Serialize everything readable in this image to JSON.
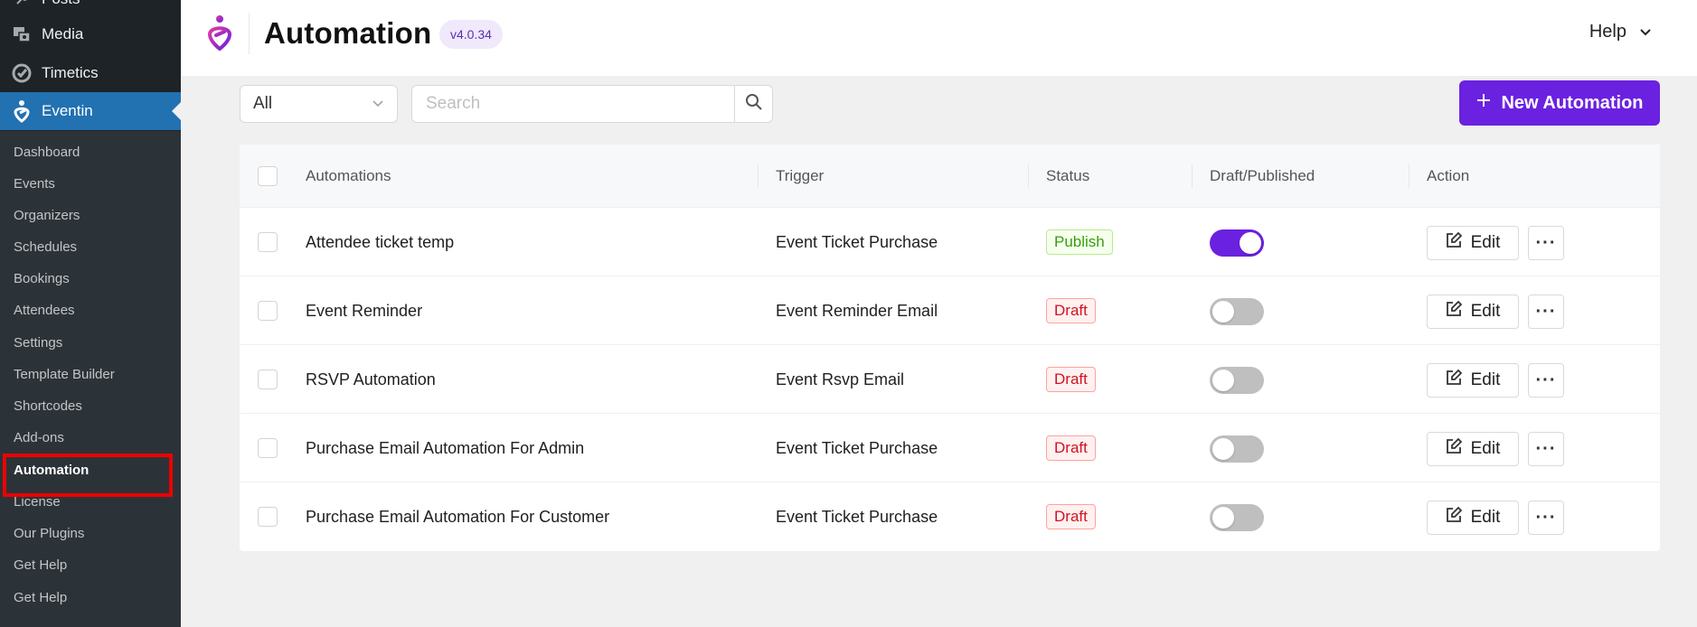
{
  "sidebar": {
    "top_items": [
      {
        "label": "Posts",
        "icon": "pin-icon"
      },
      {
        "label": "Media",
        "icon": "media-icon"
      },
      {
        "label": "Timetics",
        "icon": "timetics-icon"
      },
      {
        "label": "Eventin",
        "icon": "eventin-icon"
      }
    ],
    "submenu": [
      "Dashboard",
      "Events",
      "Organizers",
      "Schedules",
      "Bookings",
      "Attendees",
      "Settings",
      "Template Builder",
      "Shortcodes",
      "Add-ons",
      "Automation",
      "License",
      "Our Plugins",
      "Get Help",
      "Get Help"
    ],
    "current_submenu": "Automation"
  },
  "header": {
    "title": "Automation",
    "version": "v4.0.34",
    "help_label": "Help"
  },
  "toolbar": {
    "filter_value": "All",
    "search_placeholder": "Search",
    "new_button_label": "New Automation"
  },
  "table": {
    "columns": [
      "Automations",
      "Trigger",
      "Status",
      "Draft/Published",
      "Action"
    ],
    "rows": [
      {
        "name": "Attendee ticket temp",
        "trigger": "Event Ticket Purchase",
        "status": "Publish",
        "published": true,
        "action": "Edit"
      },
      {
        "name": "Event Reminder",
        "trigger": "Event Reminder Email",
        "status": "Draft",
        "published": false,
        "action": "Edit"
      },
      {
        "name": "RSVP Automation",
        "trigger": "Event Rsvp Email",
        "status": "Draft",
        "published": false,
        "action": "Edit"
      },
      {
        "name": "Purchase Email Automation For Admin",
        "trigger": "Event Ticket Purchase",
        "status": "Draft",
        "published": false,
        "action": "Edit"
      },
      {
        "name": "Purchase Email Automation For Customer",
        "trigger": "Event Ticket Purchase",
        "status": "Draft",
        "published": false,
        "action": "Edit"
      }
    ]
  },
  "colors": {
    "accent": "#6b21e0",
    "wp_active": "#2271b1",
    "sidebar_bg": "#1d2327",
    "highlight": "#ee0000"
  }
}
